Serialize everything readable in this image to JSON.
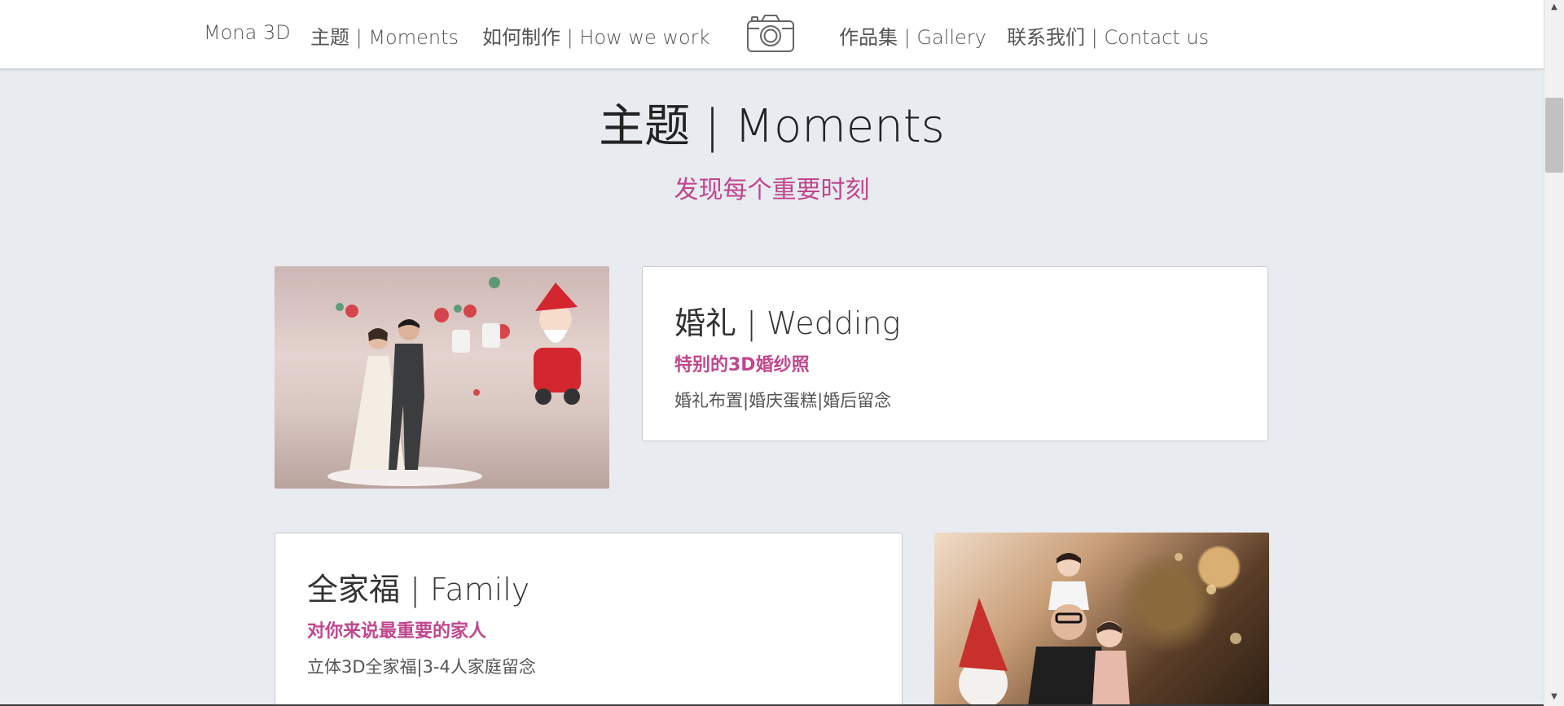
{
  "nav": {
    "brand": "Mona 3D",
    "moments": "主题 | Moments",
    "how": "如何制作 | How we work",
    "camera_icon": "camera-icon",
    "gallery": "作品集 | Gallery",
    "contact": "联系我们 | Contact us"
  },
  "main": {
    "title": "主题 | Moments",
    "subtitle": "发现每个重要时刻"
  },
  "cards": {
    "wedding": {
      "title": "婚礼 | Wedding",
      "tagline": "特别的3D婚纱照",
      "description": "婚礼布置|婚庆蛋糕|婚后留念"
    },
    "family": {
      "title": "全家福 | Family",
      "tagline": "对你来说最重要的家人",
      "description": "立体3D全家福|3-4人家庭留念"
    }
  },
  "colors": {
    "accent": "#c0468e",
    "background": "#e8ebf0"
  },
  "scrollbar": {
    "up_icon": "▲",
    "down_icon": "▼"
  }
}
